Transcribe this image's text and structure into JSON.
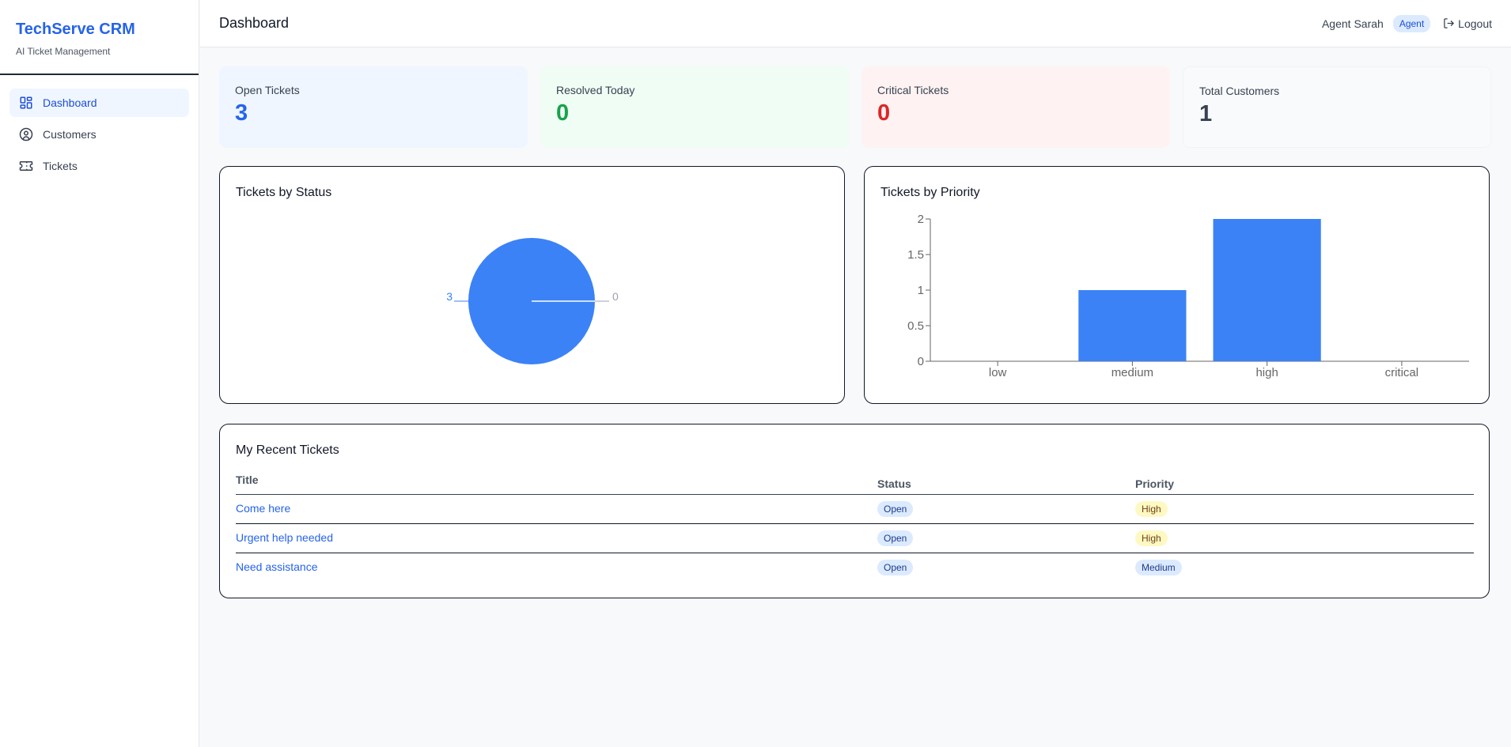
{
  "brand": {
    "title": "TechServe CRM",
    "subtitle": "AI Ticket Management"
  },
  "sidebar": {
    "items": [
      {
        "label": "Dashboard",
        "icon": "dashboard-icon"
      },
      {
        "label": "Customers",
        "icon": "user-circle-icon"
      },
      {
        "label": "Tickets",
        "icon": "ticket-icon"
      }
    ]
  },
  "header": {
    "title": "Dashboard",
    "user_name": "Agent Sarah",
    "role": "Agent",
    "logout_label": "Logout"
  },
  "stats": [
    {
      "label": "Open Tickets",
      "value": "3",
      "color": "#2563eb",
      "bg": "#eff6ff"
    },
    {
      "label": "Resolved Today",
      "value": "0",
      "color": "#16a34a",
      "bg": "#f0fdf4"
    },
    {
      "label": "Critical Tickets",
      "value": "0",
      "color": "#dc2626",
      "bg": "#fef2f2"
    },
    {
      "label": "Total Customers",
      "value": "1",
      "color": "#374151",
      "bg": "#f9fafb"
    }
  ],
  "status_card": {
    "title": "Tickets by Status"
  },
  "priority_card": {
    "title": "Tickets by Priority"
  },
  "chart_data": [
    {
      "type": "pie",
      "title": "Tickets by Status",
      "slices": [
        {
          "label": "3",
          "value": 3,
          "color": "#3b82f6"
        },
        {
          "label": "0",
          "value": 0,
          "color": "#9ca3af"
        }
      ]
    },
    {
      "type": "bar",
      "title": "Tickets by Priority",
      "categories": [
        "low",
        "medium",
        "high",
        "critical"
      ],
      "values": [
        0,
        1,
        2,
        0
      ],
      "ylim": [
        0,
        2
      ],
      "yticks": [
        "0",
        "0.5",
        "1",
        "1.5",
        "2"
      ],
      "bar_color": "#3b82f6"
    }
  ],
  "recent": {
    "title": "My Recent Tickets",
    "headers": {
      "title": "Title",
      "status": "Status",
      "priority": "Priority"
    },
    "rows": [
      {
        "title": "Come here",
        "status": "Open",
        "priority": "High",
        "priority_style": "yellow"
      },
      {
        "title": "Urgent help needed",
        "status": "Open",
        "priority": "High",
        "priority_style": "yellow"
      },
      {
        "title": "Need assistance",
        "status": "Open",
        "priority": "Medium",
        "priority_style": "blue"
      }
    ]
  }
}
